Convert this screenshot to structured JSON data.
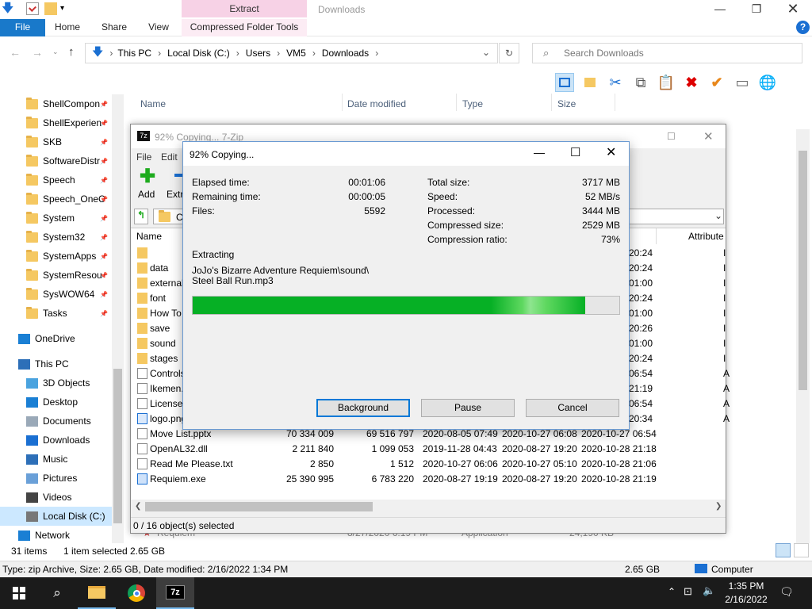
{
  "explorer": {
    "ribbon_context": "Extract",
    "window_title": "Downloads",
    "tabs": {
      "file": "File",
      "home": "Home",
      "share": "Share",
      "view": "View",
      "compressed": "Compressed Folder Tools"
    },
    "help": "?",
    "breadcrumb": [
      "This PC",
      "Local Disk (C:)",
      "Users",
      "VM5",
      "Downloads"
    ],
    "search_placeholder": "Search Downloads",
    "columns": {
      "name": "Name",
      "date": "Date modified",
      "type": "Type",
      "size": "Size"
    },
    "nav": [
      {
        "label": "ShellCompon",
        "pin": true
      },
      {
        "label": "ShellExperien",
        "pin": true
      },
      {
        "label": "SKB",
        "pin": true
      },
      {
        "label": "SoftwareDistr",
        "pin": true
      },
      {
        "label": "Speech",
        "pin": true
      },
      {
        "label": "Speech_OneC",
        "pin": true
      },
      {
        "label": "System",
        "pin": true
      },
      {
        "label": "System32",
        "pin": true
      },
      {
        "label": "SystemApps",
        "pin": true
      },
      {
        "label": "SystemResou",
        "pin": true
      },
      {
        "label": "SysWOW64",
        "pin": true
      },
      {
        "label": "Tasks",
        "pin": true
      }
    ],
    "onedrive": "OneDrive",
    "thispc": "This PC",
    "pc_items": [
      "3D Objects",
      "Desktop",
      "Documents",
      "Downloads",
      "Music",
      "Pictures",
      "Videos",
      "Local Disk (C:)"
    ],
    "network": "Network",
    "hidden_row": {
      "name": "Requiem",
      "date": "8/27/2020 6:19 PM",
      "type": "Application",
      "size": "24,190 KB"
    },
    "status": {
      "items": "31 items",
      "selected": "1 item selected",
      "size": "2.65 GB"
    },
    "details": {
      "info": "Type: zip Archive, Size: 2.65 GB, Date modified: 2/16/2022 1:34 PM",
      "size": "2.65 GB",
      "location": "Computer"
    }
  },
  "zip": {
    "title": "92% Copying... 7-Zip",
    "menu": [
      "File",
      "Edit"
    ],
    "toolbar": [
      "Add",
      "Extr"
    ],
    "path_fragment": "C",
    "col_name": "Name",
    "col_attr": "Attribute",
    "rows": [
      {
        "name": "",
        "icon": "folder",
        "t": "20:24",
        "a": "I"
      },
      {
        "name": "data",
        "icon": "folder",
        "t": "20:24",
        "a": "I"
      },
      {
        "name": "external",
        "icon": "folder",
        "t": "01:00",
        "a": "I"
      },
      {
        "name": "font",
        "icon": "folder",
        "t": "20:24",
        "a": "I"
      },
      {
        "name": "How To",
        "icon": "folder",
        "t": "01:00",
        "a": "I"
      },
      {
        "name": "save",
        "icon": "folder",
        "t": "20:26",
        "a": "I"
      },
      {
        "name": "sound",
        "icon": "folder",
        "t": "01:00",
        "a": "I"
      },
      {
        "name": "stages",
        "icon": "folder",
        "t": "20:24",
        "a": "I"
      },
      {
        "name": "Controls",
        "icon": "file",
        "t": "06:54",
        "a": "A"
      },
      {
        "name": "Ikemen.",
        "icon": "file",
        "t": "21:19",
        "a": "A"
      },
      {
        "name": "License.",
        "icon": "file",
        "t": "06:54",
        "a": "A"
      },
      {
        "name": "logo.png",
        "icon": "image",
        "t": "20:34",
        "a": "A"
      }
    ],
    "full_rows": [
      {
        "name": "Move List.pptx",
        "size": "70 334 009",
        "packed": "69 516 797",
        "modified": "2020-08-05 07:49",
        "created": "2020-10-27 06:08",
        "accessed": "2020-10-27 06:54",
        "icon": "file"
      },
      {
        "name": "OpenAL32.dll",
        "size": "2 211 840",
        "packed": "1 099 053",
        "modified": "2019-11-28 04:43",
        "created": "2020-08-27 19:20",
        "accessed": "2020-10-28 21:18",
        "icon": "file"
      },
      {
        "name": "Read Me Please.txt",
        "size": "2 850",
        "packed": "1 512",
        "modified": "2020-10-27 06:06",
        "created": "2020-10-27 05:10",
        "accessed": "2020-10-28 21:06",
        "icon": "file"
      },
      {
        "name": "Requiem.exe",
        "size": "25 390 995",
        "packed": "6 783 220",
        "modified": "2020-08-27 19:19",
        "created": "2020-08-27 19:20",
        "accessed": "2020-10-28 21:19",
        "icon": "exe"
      }
    ],
    "status": "0 / 16 object(s) selected"
  },
  "dialog": {
    "title": "92% Copying...",
    "elapsed_label": "Elapsed time:",
    "elapsed": "00:01:06",
    "remaining_label": "Remaining time:",
    "remaining": "00:00:05",
    "files_label": "Files:",
    "files": "5592",
    "total_label": "Total size:",
    "total": "3717 MB",
    "speed_label": "Speed:",
    "speed": "52 MB/s",
    "processed_label": "Processed:",
    "processed": "3444 MB",
    "compressed_label": "Compressed size:",
    "compressed": "2529 MB",
    "ratio_label": "Compression ratio:",
    "ratio": "73%",
    "action": "Extracting",
    "file_line1": "JoJo's Bizarre Adventure Requiem\\sound\\",
    "file_line2": "Steel Ball Run.mp3",
    "progress": 0.92,
    "buttons": {
      "background": "Background",
      "pause": "Pause",
      "cancel": "Cancel"
    }
  },
  "taskbar": {
    "time": "1:35 PM",
    "date": "2/16/2022"
  }
}
